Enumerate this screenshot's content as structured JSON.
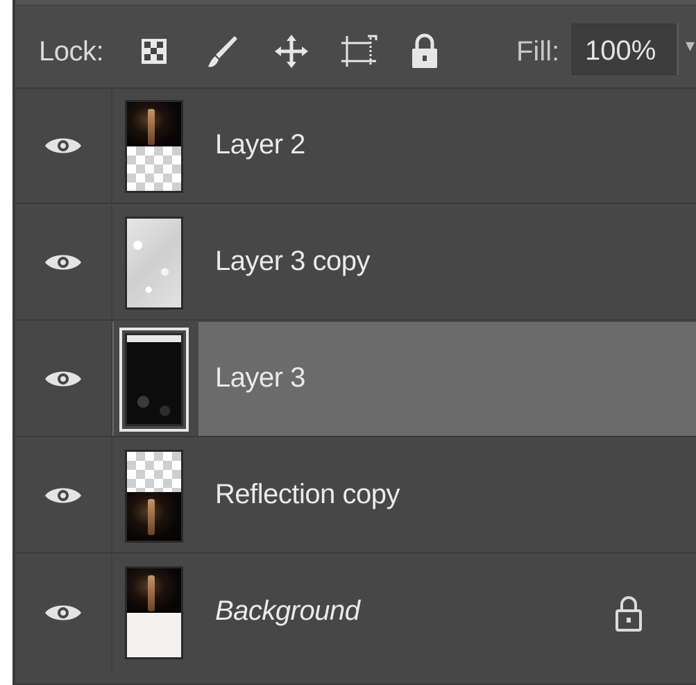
{
  "toolbar": {
    "lock_label": "Lock:",
    "lock_icons": [
      {
        "icon": "lock-transparent-pixels-icon"
      },
      {
        "icon": "lock-image-pixels-brush-icon"
      },
      {
        "icon": "lock-position-move-icon"
      },
      {
        "icon": "lock-artboard-icon"
      },
      {
        "icon": "lock-all-icon"
      }
    ],
    "fill_label": "Fill:",
    "fill_value": "100%",
    "fill_dropdown_icon": "chevron-down-icon"
  },
  "layers": [
    {
      "name": "Layer 2",
      "visible": true,
      "selected": false,
      "thumb": "photo-over-transparent",
      "locked": false,
      "italic": false
    },
    {
      "name": "Layer 3 copy",
      "visible": true,
      "selected": false,
      "thumb": "light-texture",
      "locked": false,
      "italic": false
    },
    {
      "name": "Layer 3",
      "visible": true,
      "selected": true,
      "thumb": "dark-texture",
      "locked": false,
      "italic": false
    },
    {
      "name": "Reflection copy",
      "visible": true,
      "selected": false,
      "thumb": "transparent-over-photo",
      "locked": false,
      "italic": false
    },
    {
      "name": "Background",
      "visible": true,
      "selected": false,
      "thumb": "photo-over-white",
      "locked": true,
      "italic": true
    }
  ],
  "colors": {
    "panel_bg": "#484848",
    "selected_row_bg": "#6b6b6b",
    "text": "#eaeaea"
  }
}
